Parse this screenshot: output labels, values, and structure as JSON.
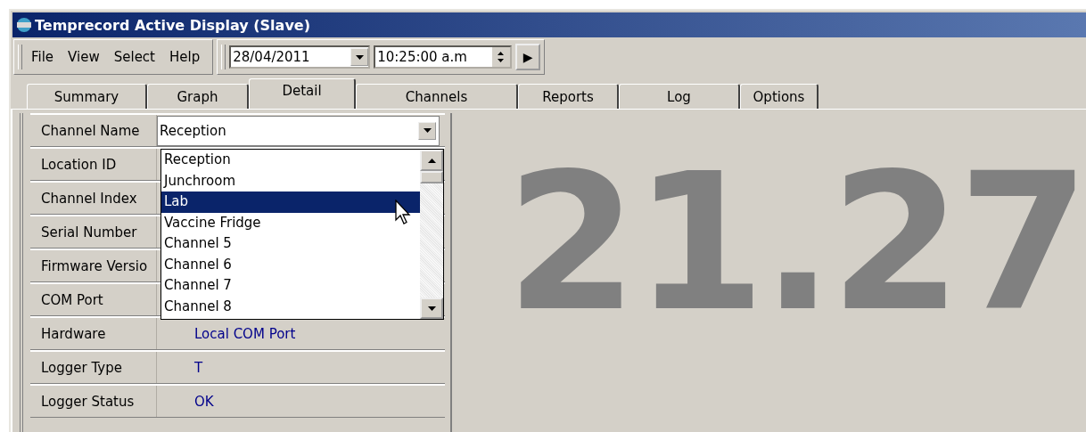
{
  "window": {
    "title": "Temprecord Active Display (Slave)"
  },
  "menu": [
    "File",
    "View",
    "Select",
    "Help"
  ],
  "toolbar": {
    "date": "28/04/2011",
    "time": "10:25:00 a.m",
    "play": "▶"
  },
  "tabs": [
    {
      "label": "Summary",
      "selected": false
    },
    {
      "label": "Graph",
      "selected": false
    },
    {
      "label": "Detail",
      "selected": true
    },
    {
      "label": "Channels",
      "selected": false
    },
    {
      "label": "Reports",
      "selected": false
    },
    {
      "label": "Log",
      "selected": false
    },
    {
      "label": "Options",
      "selected": false
    }
  ],
  "properties": [
    {
      "label": "Channel Name",
      "kind": "combo",
      "value": "Reception"
    },
    {
      "label": "Location ID",
      "kind": "hidden"
    },
    {
      "label": "Channel Index",
      "kind": "hidden"
    },
    {
      "label": "Serial Number",
      "kind": "hidden"
    },
    {
      "label": "Firmware Versio",
      "kind": "hidden"
    },
    {
      "label": "COM Port",
      "kind": "hidden"
    },
    {
      "label": "Hardware",
      "kind": "text",
      "value": "Local COM Port"
    },
    {
      "label": "Logger Type",
      "kind": "text",
      "value": "T"
    },
    {
      "label": "Logger Status",
      "kind": "text",
      "value": "OK"
    }
  ],
  "dropdown": {
    "items": [
      {
        "label": "Reception",
        "selected": false
      },
      {
        "label": "Junchroom",
        "selected": false
      },
      {
        "label": "Lab",
        "selected": true
      },
      {
        "label": "Vaccine Fridge",
        "selected": false
      },
      {
        "label": "Channel 5",
        "selected": false
      },
      {
        "label": "Channel 6",
        "selected": false
      },
      {
        "label": "Channel 7",
        "selected": false
      },
      {
        "label": "Channel 8",
        "selected": false
      }
    ]
  },
  "reading": "21.27"
}
